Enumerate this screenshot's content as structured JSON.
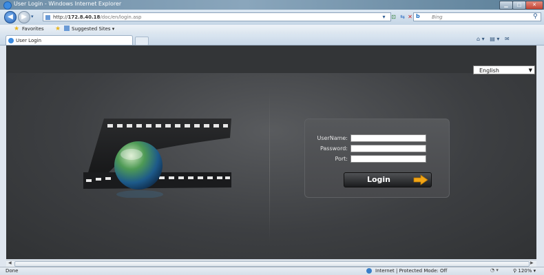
{
  "window": {
    "title": "User Login - Windows Internet Explorer"
  },
  "address": {
    "url_prefix": "http://",
    "url_host": "172.8.40.18",
    "url_path": "/doc/en/login.asp",
    "search_placeholder": "Bing"
  },
  "favorites": {
    "favorites_label": "Favorites",
    "suggested_label": "Suggested Sites ▾"
  },
  "tabs": [
    {
      "label": "User Login"
    }
  ],
  "page": {
    "language": "English",
    "labels": {
      "username": "UserName:",
      "password": "Password:",
      "port": "Port:"
    },
    "values": {
      "username": "",
      "password": "",
      "port": ""
    },
    "login_button": "Login"
  },
  "status": {
    "left": "Done",
    "zone": "Internet | Protected Mode: Off",
    "zoom": "120%"
  },
  "colors": {
    "accent_arrow": "#f2a516",
    "panel_bg": "#4e5053",
    "page_bg": "#3d3f42"
  }
}
